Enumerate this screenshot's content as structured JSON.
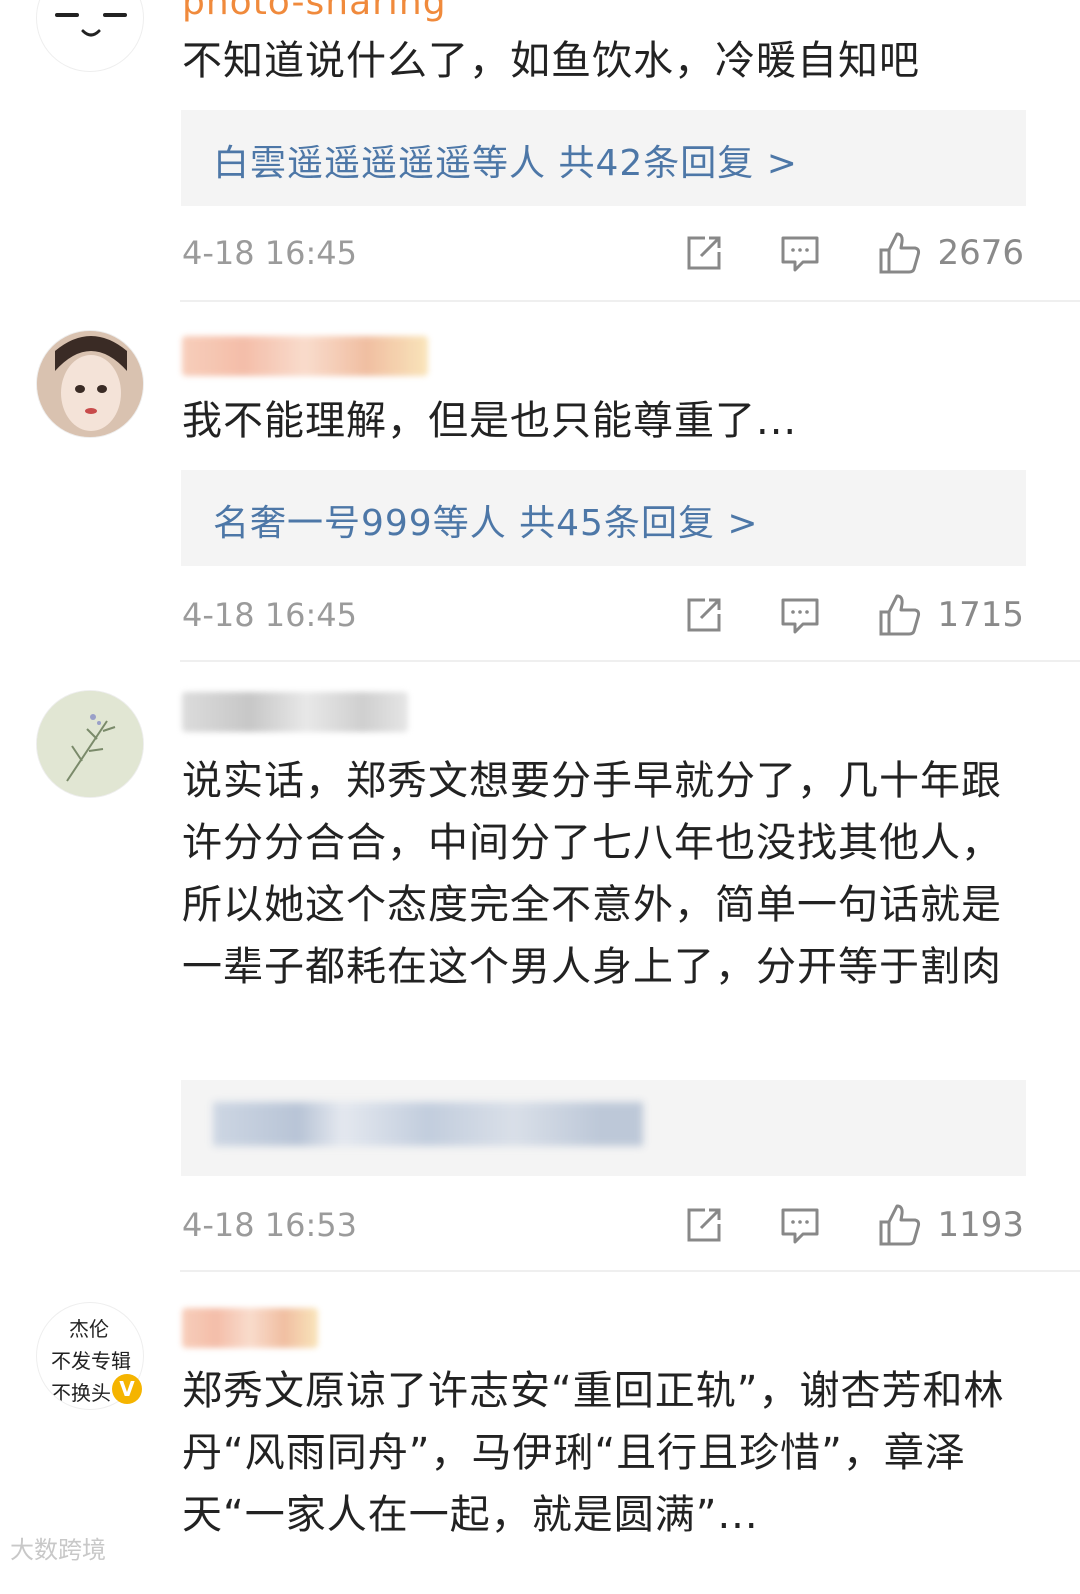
{
  "comments": [
    {
      "username": "photo-sharing",
      "text": "不知道说什么了，如鱼饮水，冷暖自知吧",
      "reply_summary": "白雲遥遥遥遥遥等人  共42条回复 >",
      "time": "4-18 16:45",
      "likes": "2676"
    },
    {
      "username": "",
      "text": "我不能理解，但是也只能尊重了...",
      "reply_summary": "名奢一号999等人  共45条回复 >",
      "time": "4-18 16:45",
      "likes": "1715"
    },
    {
      "username": "",
      "text": "说实话，郑秀文想要分手早就分了，几十年跟许分分合合，中间分了七八年也没找其他人，所以她这个态度完全不意外，简单一句话就是一辈子都耗在这个男人身上了，分开等于割肉",
      "reply_summary": "",
      "time": "4-18 16:53",
      "likes": "1193"
    },
    {
      "username": "",
      "avatar_text": [
        "杰伦",
        "不发专辑",
        "不换头"
      ],
      "text": "郑秀文原谅了许志安“重回正轨”，谢杏芳和林丹“风雨同舟”，马伊琍“且行且珍惜”，章泽天“一家人在一起，就是圆满”...",
      "reply_summary": "",
      "time": "",
      "likes": ""
    }
  ],
  "watermark": "大数跨境",
  "colors": {
    "link": "#4d77a7",
    "meta": "#9b9b9b",
    "reply_bg": "#f4f4f4",
    "username_orange": "#f08a3c",
    "verified_badge": "#f5b400"
  },
  "icons": [
    "share-icon",
    "comment-icon",
    "like-icon"
  ]
}
